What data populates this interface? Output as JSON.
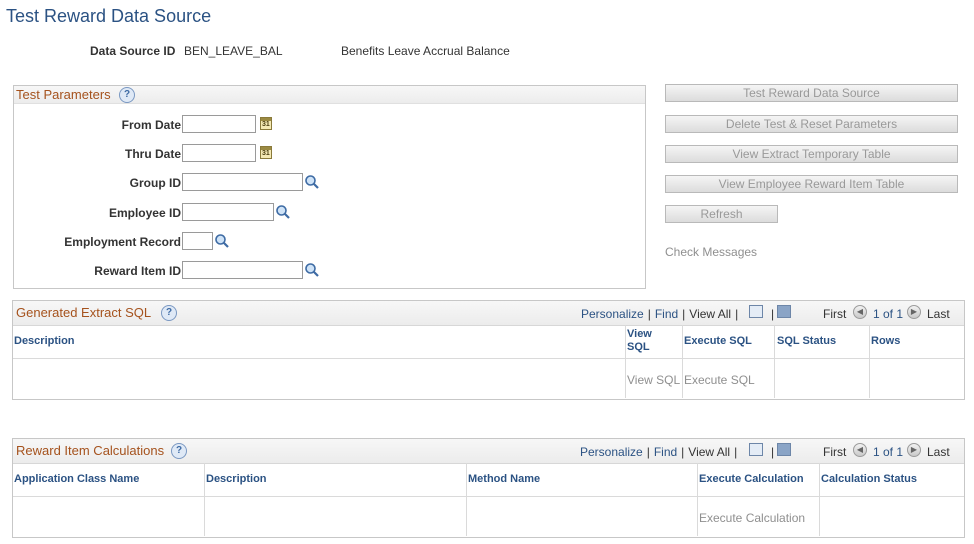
{
  "page": {
    "title": "Test Reward Data Source",
    "data_source_id_label": "Data Source ID",
    "data_source_id_value": "BEN_LEAVE_BAL",
    "data_source_description": "Benefits Leave Accrual Balance"
  },
  "test_parameters": {
    "title": "Test Parameters",
    "help": "?",
    "from_date_label": "From Date",
    "from_date_value": "",
    "thru_date_label": "Thru Date",
    "thru_date_value": "",
    "group_id_label": "Group ID",
    "group_id_value": "",
    "employee_id_label": "Employee ID",
    "employee_id_value": "",
    "employment_record_label": "Employment Record",
    "employment_record_value": "",
    "reward_item_id_label": "Reward Item ID",
    "reward_item_id_value": ""
  },
  "actions": {
    "test_label": "Test Reward Data Source",
    "delete_label": "Delete Test & Reset Parameters",
    "view_extract_label": "View Extract Temporary Table",
    "view_employee_label": "View Employee Reward Item Table",
    "refresh_label": "Refresh",
    "check_messages_label": "Check Messages"
  },
  "extract_sql_grid": {
    "title": "Generated Extract SQL",
    "help": "?",
    "personalize": "Personalize",
    "find": "Find",
    "view_all": "View All",
    "first": "First",
    "count": "1 of 1",
    "last": "Last",
    "columns": {
      "description": "Description",
      "view_sql_1": "View",
      "view_sql_2": "SQL",
      "execute_sql": "Execute SQL",
      "sql_status": "SQL Status",
      "rows": "Rows"
    },
    "row": {
      "description": "",
      "view_sql": "View SQL",
      "execute_sql": "Execute SQL",
      "sql_status": "",
      "rows": ""
    }
  },
  "reward_calc_grid": {
    "title": "Reward Item Calculations",
    "help": "?",
    "personalize": "Personalize",
    "find": "Find",
    "view_all": "View All",
    "first": "First",
    "count": "1 of 1",
    "last": "Last",
    "columns": {
      "app_class": "Application Class Name",
      "description": "Description",
      "method": "Method Name",
      "execute_calc": "Execute Calculation",
      "calc_status": "Calculation Status"
    },
    "row": {
      "app_class": "",
      "description": "",
      "method": "",
      "execute_calc": "Execute Calculation",
      "calc_status": ""
    }
  },
  "colors": {
    "title_blue": "#2b5283",
    "group_title_orange": "#a5521d",
    "disabled_text": "#999999"
  },
  "icons": {
    "calendar": "calendar-icon",
    "lookup": "magnifier-icon",
    "help": "question-mark-icon",
    "zoom": "zoom-grid-icon",
    "download": "download-to-excel-icon",
    "prev": "triangle-left-icon",
    "next": "triangle-right-icon"
  }
}
